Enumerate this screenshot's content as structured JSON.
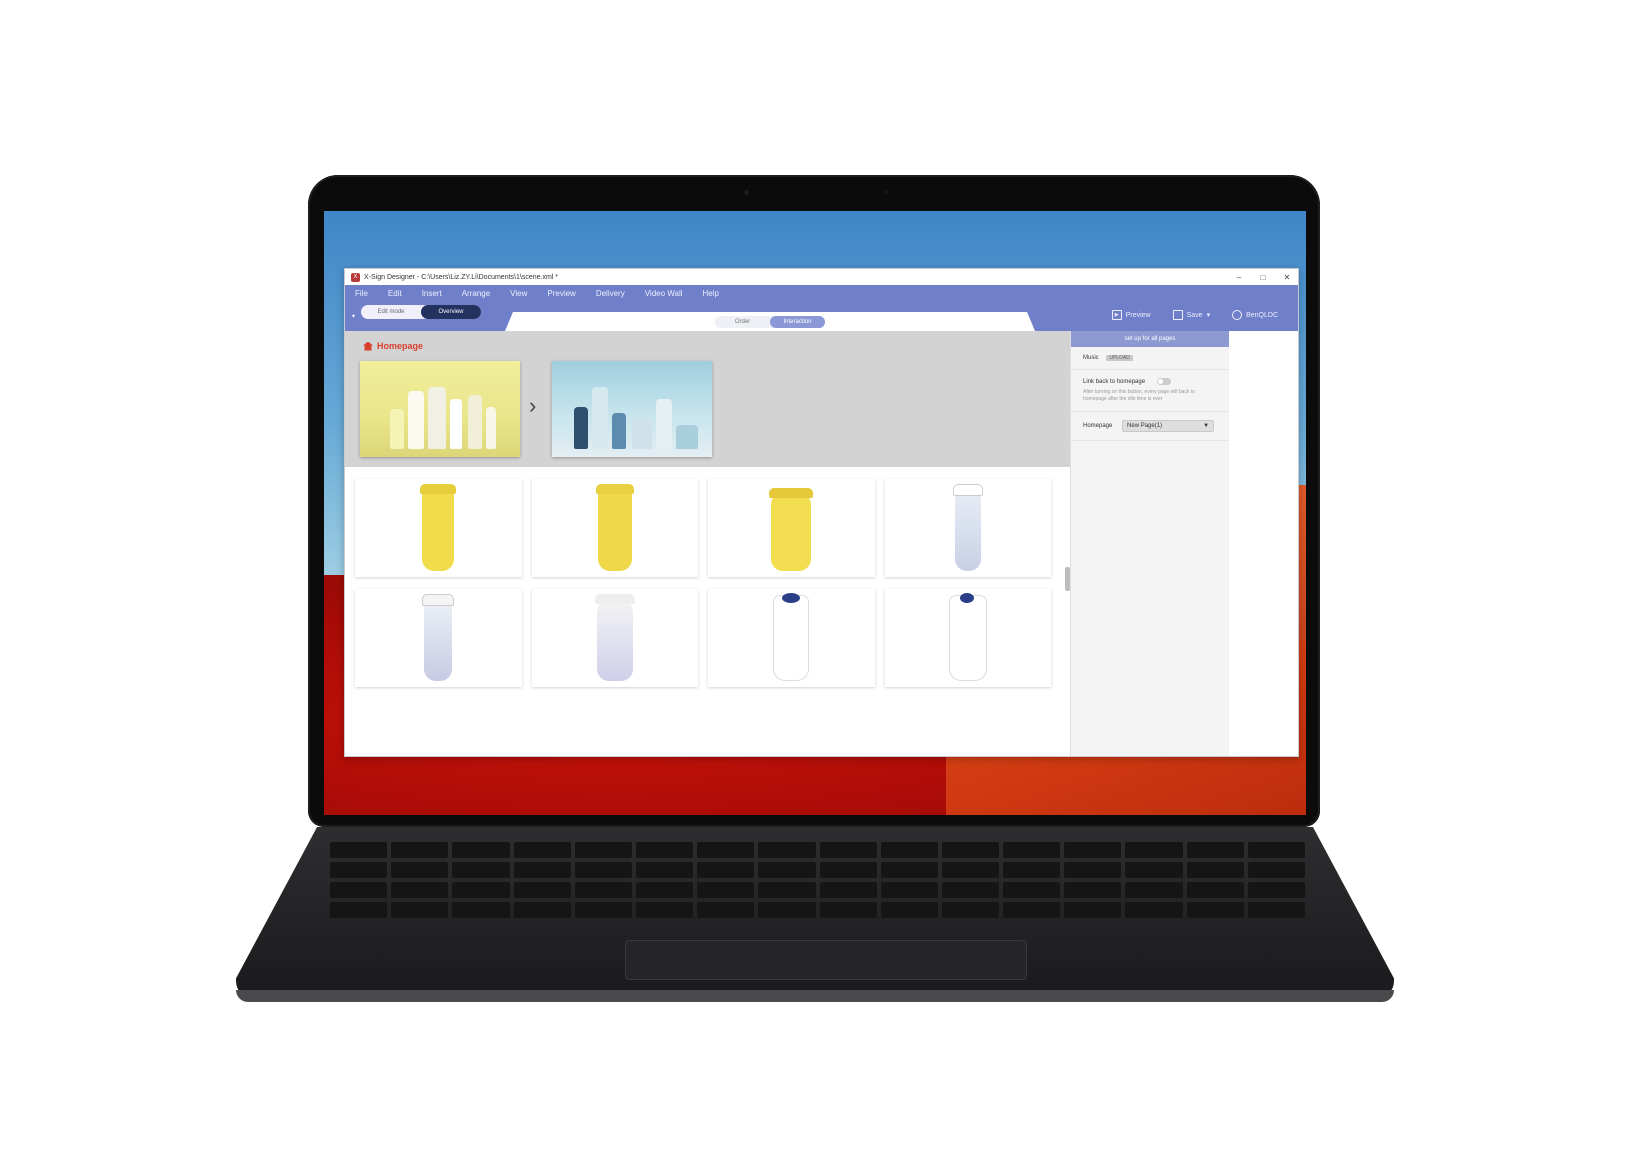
{
  "window": {
    "title": "X-Sign Designer - C:\\Users\\Liz.ZY.Li\\Documents\\1\\scene.xml *",
    "controls": [
      "–",
      "□",
      "✕"
    ]
  },
  "menu": [
    "File",
    "Edit",
    "Insert",
    "Arrange",
    "View",
    "Preview",
    "Delivery",
    "Video Wall",
    "Help"
  ],
  "toolbar": {
    "mode_options": [
      "Edit mode",
      "Overview"
    ],
    "active_mode": "Overview",
    "segments": [
      "Order",
      "Interaction"
    ],
    "active_segment": "Interaction",
    "preview_label": "Preview",
    "save_label": "Save",
    "user_label": "BenQLDC"
  },
  "overview": {
    "homepage_label": "Homepage"
  },
  "panel": {
    "header": "set up for all pages",
    "music_label": "Music",
    "upload_label": "UPLOAD",
    "link_back_label": "Link back to homepage",
    "link_back_hint": "After turning on this button, every page will back to homepage after the idle time is over",
    "homepage_label": "Homepage",
    "homepage_value": "New Page(1)"
  },
  "colors": {
    "accent": "#6f7fc9",
    "brand_red": "#d93f2d",
    "cup_yellow": "#f1dc4b"
  },
  "icons": {
    "home": "home-icon",
    "next": "chevron-right-icon",
    "preview": "play-icon",
    "save": "save-icon",
    "user": "user-icon"
  }
}
